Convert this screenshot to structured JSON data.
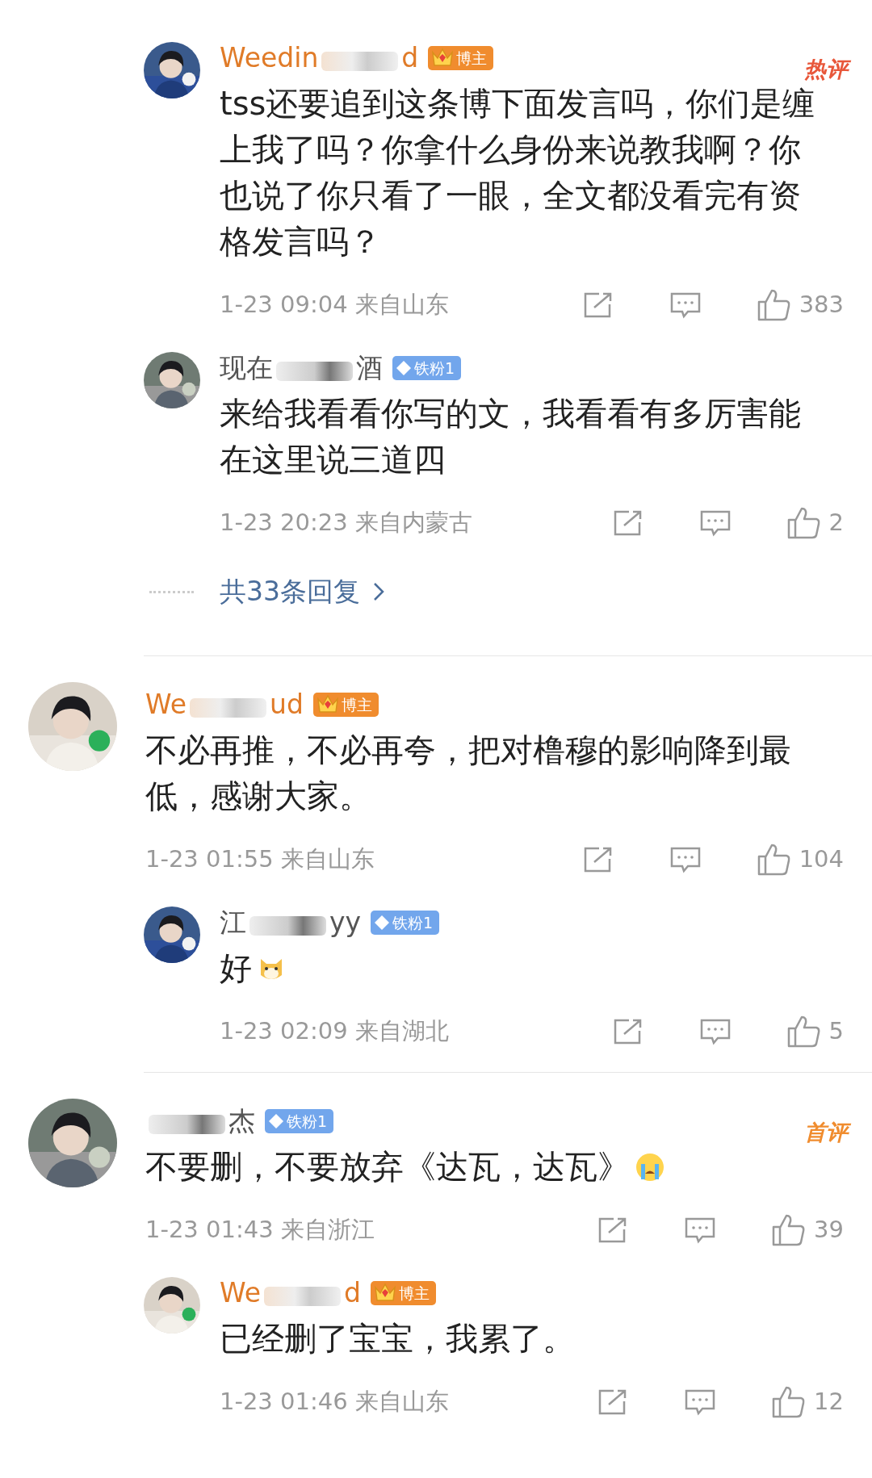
{
  "threads": [
    {
      "replies": [
        {
          "author": {
            "kind": "blogger",
            "name_start": "Weedin",
            "name_end": "d",
            "badge": "博主"
          },
          "tag": {
            "kind": "hot",
            "label": "热评"
          },
          "text": "tss还要追到这条博下面发言吗，你们是缠上我了吗？你拿什么身份来说教我啊？你也说了你只看了一眼，全文都没看完有资格发言吗？",
          "time": "1-23 09:04",
          "location": "来自山东",
          "likes": "383"
        },
        {
          "author": {
            "kind": "fan",
            "name_start": "现在",
            "name_end": "酒",
            "badge": "铁粉1"
          },
          "text": "来给我看看你写的文，我看看有多厉害能在这里说三道四",
          "time": "1-23 20:23",
          "location": "来自内蒙古",
          "likes": "2"
        }
      ],
      "more_replies": "共33条回复"
    },
    {
      "comment": {
        "author": {
          "kind": "blogger",
          "name_start": "We",
          "name_end": "ud",
          "badge": "博主"
        },
        "text": "不必再推，不必再夸，把对橹穆的影响降到最低，感谢大家。",
        "time": "1-23 01:55",
        "location": "来自山东",
        "likes": "104"
      },
      "replies": [
        {
          "author": {
            "kind": "fan",
            "name_start": "江",
            "name_end": "yy",
            "badge": "铁粉1"
          },
          "text": "好",
          "emoji": {
            "kind": "dog"
          },
          "time": "1-23 02:09",
          "location": "来自湖北",
          "likes": "5"
        }
      ]
    },
    {
      "comment": {
        "author": {
          "kind": "fan",
          "name_end": "杰",
          "badge": "铁粉1"
        },
        "tag": {
          "kind": "first",
          "label": "首评"
        },
        "text": "不要删，不要放弃《达瓦，达瓦》",
        "emoji": {
          "kind": "crying"
        },
        "time": "1-23 01:43",
        "location": "来自浙江",
        "likes": "39"
      },
      "replies": [
        {
          "author": {
            "kind": "blogger",
            "name_start": "We",
            "name_end": "d",
            "badge": "博主"
          },
          "text": "已经删了宝宝，我累了。",
          "time": "1-23 01:46",
          "location": "来自山东",
          "likes": "12"
        }
      ]
    }
  ]
}
